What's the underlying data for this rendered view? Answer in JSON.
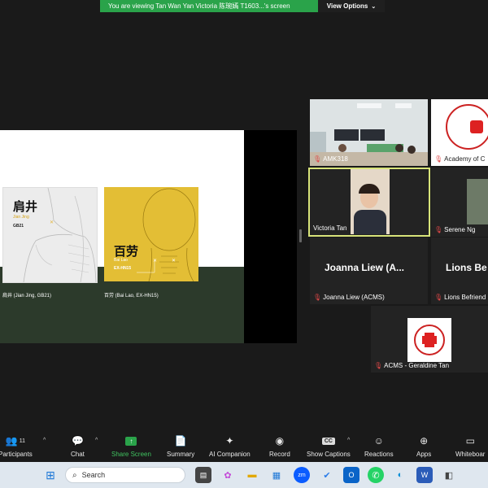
{
  "banner": {
    "message": "You are viewing Tan Wan Yan Victoria 陈琬嫣 T1603...'s screen",
    "view_options": "View Options"
  },
  "slide": {
    "card1": {
      "title": "肩井",
      "pinyin": "Jian Jing",
      "code": "GB21",
      "caption": "肩井 (Jian Jing, GB21)"
    },
    "card2": {
      "title": "百劳",
      "pinyin": "Bai Lao",
      "code": "EX-HN15",
      "caption": "百劳 (Bai Lao, EX-HN15)"
    }
  },
  "participants": [
    {
      "name": "AMK318"
    },
    {
      "name": "Academy of C"
    },
    {
      "name": "Victoria Tan"
    },
    {
      "name": "Serene Ng"
    },
    {
      "name": "Joanna Liew (ACMS)",
      "display": "Joanna Liew (A..."
    },
    {
      "name": "Lions Befriend",
      "display": "Lions Be"
    },
    {
      "name": "ACMS - Geraldine Tan"
    }
  ],
  "toolbar": {
    "participants": "Participants",
    "participants_count": "11",
    "chat": "Chat",
    "share_screen": "Share Screen",
    "summary": "Summary",
    "ai_companion": "AI Companion",
    "record": "Record",
    "captions": "Show Captions",
    "captions_badge": "CC",
    "reactions": "Reactions",
    "apps": "Apps",
    "whiteboard": "Whiteboar"
  },
  "taskbar": {
    "search_placeholder": "Search"
  },
  "colors": {
    "share_green": "#2aa34a",
    "active_border": "#d8e47a",
    "slide_green": "#2c3a2b",
    "card_yellow": "#e3be35"
  }
}
